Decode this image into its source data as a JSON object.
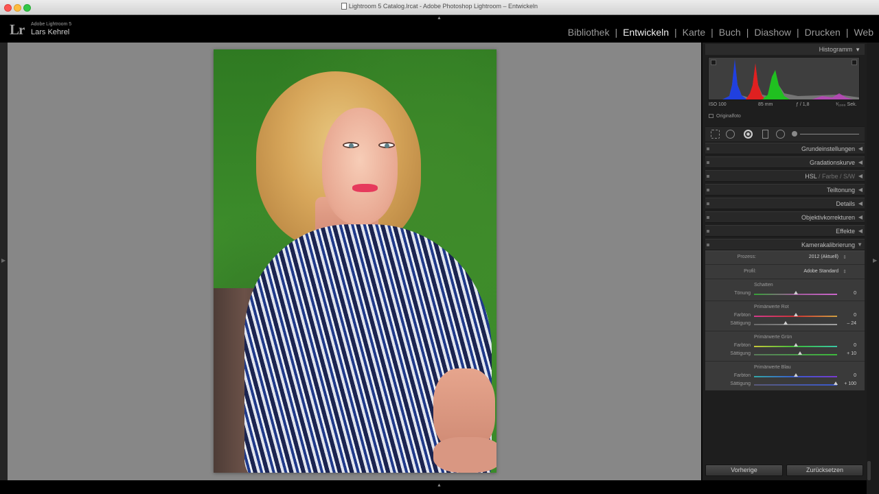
{
  "window": {
    "title": "Lightroom 5 Catalog.lrcat - Adobe Photoshop Lightroom – Entwickeln"
  },
  "brand": {
    "logo": "Lr",
    "app": "Adobe Lightroom 5",
    "user": "Lars Kehrel"
  },
  "modules": [
    {
      "label": "Bibliothek",
      "active": false
    },
    {
      "label": "Entwickeln",
      "active": true
    },
    {
      "label": "Karte",
      "active": false
    },
    {
      "label": "Buch",
      "active": false
    },
    {
      "label": "Diashow",
      "active": false
    },
    {
      "label": "Drucken",
      "active": false
    },
    {
      "label": "Web",
      "active": false
    }
  ],
  "histogram": {
    "title": "Histogramm",
    "iso": "ISO 100",
    "focal": "85 mm",
    "aperture": "ƒ / 1,8",
    "shutter": "¹⁄₁₀₀₀ Sek.",
    "original_label": "Originalfoto"
  },
  "sections": {
    "basic": "Grundeinstellungen",
    "curve": "Gradationskurve",
    "hsl": "HSL",
    "color": "Farbe",
    "bw": "S/W",
    "split": "Teiltonung",
    "details": "Details",
    "lens": "Objektivkorrekturen",
    "effects": "Effekte",
    "calibration": "Kamerakalibrierung"
  },
  "calibration": {
    "process_label": "Prozess:",
    "process_value": "2012 (Aktuell)",
    "profile_label": "Profil:",
    "profile_value": "Adobe Standard",
    "shadows": {
      "title": "Schatten",
      "tint_label": "Tönung",
      "tint_value": "0"
    },
    "red": {
      "title": "Primärwerte Rot",
      "hue_label": "Farbton",
      "hue_value": "0",
      "sat_label": "Sättigung",
      "sat_value": "– 24"
    },
    "green": {
      "title": "Primärwerte Grün",
      "hue_label": "Farbton",
      "hue_value": "0",
      "sat_label": "Sättigung",
      "sat_value": "+ 10"
    },
    "blue": {
      "title": "Primärwerte Blau",
      "hue_label": "Farbton",
      "hue_value": "0",
      "sat_label": "Sättigung",
      "sat_value": "+ 100"
    }
  },
  "buttons": {
    "previous": "Vorherige",
    "reset": "Zurücksetzen"
  },
  "colors": {
    "accent_red": "#cc3333",
    "accent_green": "#3cbc3c",
    "accent_blue": "#3a5ad0",
    "panel_bg": "#1e1e1e",
    "canvas_bg": "#878787"
  }
}
